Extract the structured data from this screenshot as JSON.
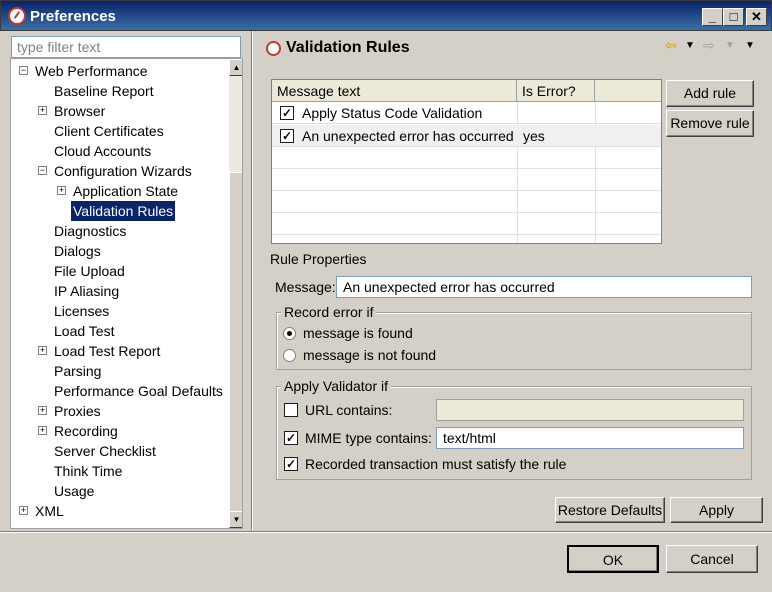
{
  "window": {
    "title": "Preferences"
  },
  "filter": {
    "placeholder": "type filter text"
  },
  "tree": {
    "items": [
      "Web Performance",
      "Baseline Report",
      "Browser",
      "Client Certificates",
      "Cloud Accounts",
      "Configuration Wizards",
      "Application State",
      "Validation Rules",
      "Diagnostics",
      "Dialogs",
      "File Upload",
      "IP Aliasing",
      "Licenses",
      "Load Test",
      "Load Test Report",
      "Parsing",
      "Performance Goal Defaults",
      "Proxies",
      "Recording",
      "Server Checklist",
      "Think Time",
      "Usage",
      "XML"
    ]
  },
  "page": {
    "title": "Validation Rules"
  },
  "table": {
    "headers": [
      "Message text",
      "Is Error?"
    ],
    "rows": [
      {
        "checked": true,
        "message": "Apply Status Code Validation",
        "is_error": ""
      },
      {
        "checked": true,
        "message": "An unexpected error has occurred",
        "is_error": "yes"
      }
    ]
  },
  "buttons": {
    "add_rule": "Add rule",
    "remove_rule": "Remove rule",
    "restore_defaults": "Restore Defaults",
    "apply": "Apply",
    "ok": "OK",
    "cancel": "Cancel"
  },
  "rule_properties": {
    "title": "Rule Properties",
    "message_label": "Message:",
    "message_value": "An unexpected error has occurred"
  },
  "record_error": {
    "title": "Record error if",
    "options": [
      "message is found",
      "message is not found"
    ],
    "selected": "message is found"
  },
  "apply_validator": {
    "title": "Apply Validator if",
    "url_label": "URL contains:",
    "url_checked": false,
    "url_value": "",
    "mime_label": "MIME type contains:",
    "mime_checked": true,
    "mime_value": "text/html",
    "recorded_label": "Recorded transaction must satisfy the rule",
    "recorded_checked": true
  }
}
